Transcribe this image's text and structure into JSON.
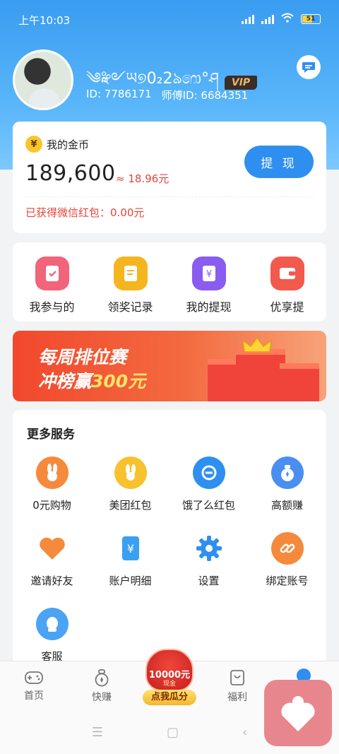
{
  "status_bar": {
    "time": "上午10:03",
    "battery": "51"
  },
  "profile": {
    "nickname": "༄ཱ༻ཡ୭0₂2ঌ෩°ཤ",
    "vip_label": "VIP",
    "id_text": "ID: 7786171",
    "master_id_text": "师傅ID: 6684351"
  },
  "coins": {
    "title": "我的金币",
    "icon_char": "¥",
    "balance": "189,600",
    "rmb_equiv": "≈ 18.96元",
    "withdraw_label": "提 现",
    "redpack_text": "已获得微信红包：0.00元"
  },
  "quick_actions": [
    {
      "label": "我参与的",
      "icon": "participation-icon",
      "color": "#f2647a"
    },
    {
      "label": "领奖记录",
      "icon": "prize-record-icon",
      "color": "#f5b51e"
    },
    {
      "label": "我的提现",
      "icon": "withdraw-record-icon",
      "color": "#8a5cf0"
    },
    {
      "label": "优享提",
      "icon": "wallet-icon",
      "color": "#f25a4d"
    }
  ],
  "banner": {
    "line1": "每周排位赛",
    "line2_a": "冲榜赢",
    "line2_b": "300元"
  },
  "services": {
    "title": "更多服务",
    "items": [
      {
        "label": "0元购物",
        "icon": "rabbit-icon",
        "color": "#f58a3c"
      },
      {
        "label": "美团红包",
        "icon": "meituan-icon",
        "color": "#f7c22e"
      },
      {
        "label": "饿了么红包",
        "icon": "eleme-icon",
        "color": "#2f8ff0"
      },
      {
        "label": "高额赚",
        "icon": "money-bag-icon",
        "color": "#4a8ef2"
      },
      {
        "label": "邀请好友",
        "icon": "heart-icon",
        "color": "#f58a3c"
      },
      {
        "label": "账户明细",
        "icon": "ledger-icon",
        "color": "#3aa0f0"
      },
      {
        "label": "设置",
        "icon": "gear-icon",
        "color": "#2f8ff0"
      },
      {
        "label": "绑定账号",
        "icon": "link-icon",
        "color": "#f58a3c"
      },
      {
        "label": "客服",
        "icon": "support-icon",
        "color": "#4aa3f5"
      }
    ]
  },
  "tabbar": {
    "tabs": [
      {
        "label": "首页",
        "icon": "gamepad-icon"
      },
      {
        "label": "快赚",
        "icon": "quick-earn-icon"
      },
      {
        "label": "福利",
        "icon": "welfare-icon"
      }
    ],
    "promo": {
      "amount": "10000元",
      "sub": "现金",
      "cta": "点我瓜分"
    }
  },
  "nav": {
    "menu": "☰",
    "home": "▢",
    "back": "‹"
  }
}
